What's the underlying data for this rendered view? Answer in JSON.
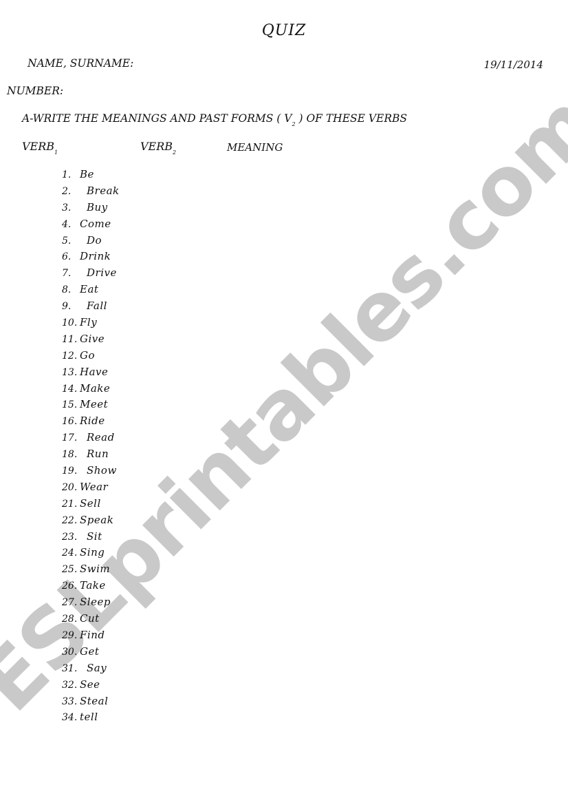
{
  "watermark": "ESLprintables.com",
  "colors": {
    "text": "#111111",
    "watermark": "#c9c9c9",
    "background": "#ffffff"
  },
  "header": {
    "title": "QUIZ",
    "name_label": "NAME, SURNAME:",
    "date": "19/11/2014",
    "number_label": "NUMBER:"
  },
  "instruction": {
    "text_before": "A-WRITE THE MEANINGS AND PAST FORMS ( V",
    "subscript": "2",
    "text_after": " )  OF THESE VERBS"
  },
  "columns": {
    "verb1": {
      "label": "VERB",
      "subscript": "1"
    },
    "verb2": {
      "label": "VERB",
      "subscript": "2"
    },
    "meaning": {
      "label": "MEANING"
    }
  },
  "verbs": [
    {
      "num": "1.",
      "word": "Be",
      "indent": false
    },
    {
      "num": "2.",
      "word": "Break",
      "indent": true
    },
    {
      "num": "3.",
      "word": "Buy",
      "indent": true
    },
    {
      "num": "4.",
      "word": "Come",
      "indent": false
    },
    {
      "num": "5.",
      "word": "Do",
      "indent": true
    },
    {
      "num": "6.",
      "word": "Drink",
      "indent": false
    },
    {
      "num": "7.",
      "word": "Drive",
      "indent": true
    },
    {
      "num": "8.",
      "word": "Eat",
      "indent": false
    },
    {
      "num": "9.",
      "word": "Fall",
      "indent": true
    },
    {
      "num": "10.",
      "word": "Fly",
      "indent": false
    },
    {
      "num": "11.",
      "word": "Give",
      "indent": false
    },
    {
      "num": "12.",
      "word": "Go",
      "indent": false
    },
    {
      "num": "13.",
      "word": "Have",
      "indent": false
    },
    {
      "num": "14.",
      "word": "Make",
      "indent": false
    },
    {
      "num": "15.",
      "word": "Meet",
      "indent": false
    },
    {
      "num": "16.",
      "word": "Ride",
      "indent": false
    },
    {
      "num": "17.",
      "word": "Read",
      "indent": true
    },
    {
      "num": "18.",
      "word": "Run",
      "indent": true
    },
    {
      "num": "19.",
      "word": "Show",
      "indent": true
    },
    {
      "num": "20.",
      "word": "Wear",
      "indent": false
    },
    {
      "num": "21.",
      "word": "Sell",
      "indent": false
    },
    {
      "num": "22.",
      "word": "Speak",
      "indent": false
    },
    {
      "num": "23.",
      "word": "Sit",
      "indent": true
    },
    {
      "num": "24.",
      "word": "Sing",
      "indent": false
    },
    {
      "num": "25.",
      "word": "Swim",
      "indent": false
    },
    {
      "num": "26.",
      "word": "Take",
      "indent": false
    },
    {
      "num": "27.",
      "word": "Sleep",
      "indent": false
    },
    {
      "num": "28.",
      "word": "Cut",
      "indent": false
    },
    {
      "num": "29.",
      "word": "Find",
      "indent": false
    },
    {
      "num": "30.",
      "word": "Get",
      "indent": false
    },
    {
      "num": "31.",
      "word": "Say",
      "indent": true
    },
    {
      "num": "32.",
      "word": "See",
      "indent": false
    },
    {
      "num": "33.",
      "word": "Steal",
      "indent": false
    },
    {
      "num": "34.",
      "word": "tell",
      "indent": false
    }
  ]
}
